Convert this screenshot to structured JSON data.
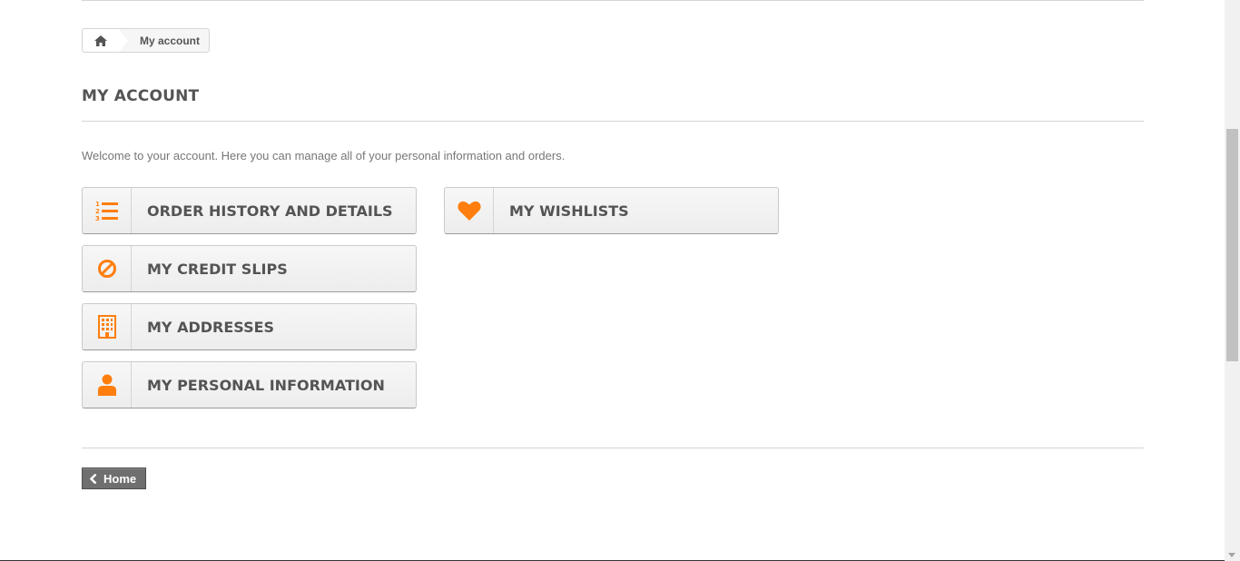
{
  "breadcrumb": {
    "home_icon": "home-icon",
    "current": "My account"
  },
  "page": {
    "title": "My account",
    "intro": "Welcome to your account. Here you can manage all of your personal information and orders."
  },
  "links_left": [
    {
      "label": "Order history and details",
      "icon": "ordered-list-icon"
    },
    {
      "label": "My credit slips",
      "icon": "ban-icon"
    },
    {
      "label": "My addresses",
      "icon": "building-icon"
    },
    {
      "label": "My personal information",
      "icon": "user-icon"
    }
  ],
  "links_right": [
    {
      "label": "My wishlists",
      "icon": "heart-icon"
    }
  ],
  "footer": {
    "home_label": "Home"
  },
  "colors": {
    "accent": "#ff7e0e",
    "text": "#555454",
    "button_dark": "#6f6f6f"
  }
}
